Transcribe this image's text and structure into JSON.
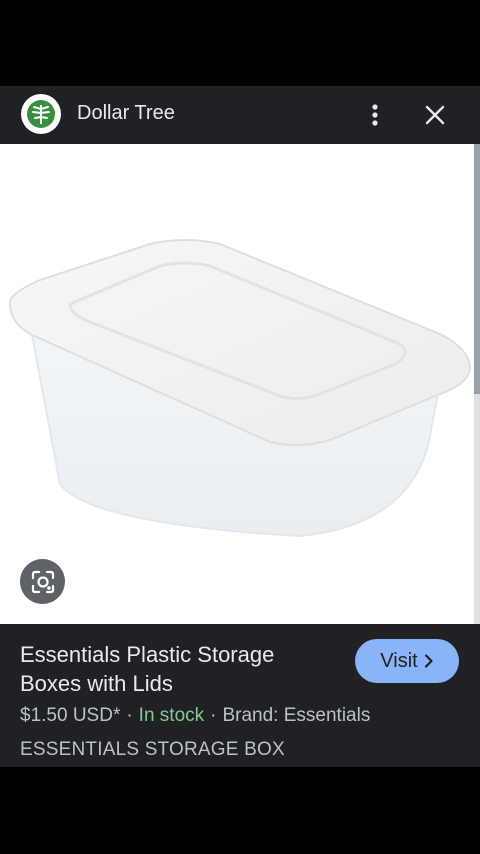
{
  "header": {
    "site_name": "Dollar Tree",
    "logo_icon": "dollar-tree-logo",
    "menu_icon": "more-vert-icon",
    "close_icon": "close-icon"
  },
  "product_image": {
    "subject": "storage-box-image"
  },
  "lens_icon": "lens-icon",
  "product": {
    "title": "Essentials Plastic Storage Boxes with Lids",
    "visit_label": "Visit",
    "price": "$1.50 USD*",
    "availability": "In stock",
    "separator": "·",
    "brand": "Brand: Essentials",
    "subtitle": "ESSENTIALS STORAGE BOX"
  },
  "colors": {
    "header_bg": "#202124",
    "visit_button": "#8ab4f8",
    "in_stock": "#81c995",
    "logo_green": "#3a8f3f"
  }
}
